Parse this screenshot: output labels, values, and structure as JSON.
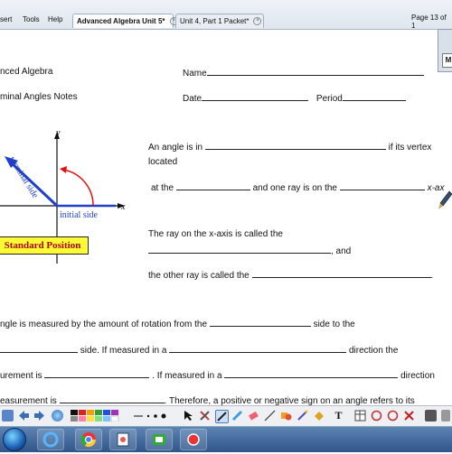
{
  "menu": {
    "insert": "sert",
    "tools": "Tools",
    "help": "Help"
  },
  "tabs": [
    {
      "label": "Advanced Algebra Unit 5*",
      "active": true
    },
    {
      "label": "Unit 4, Part 1 Packet*",
      "active": false
    }
  ],
  "page_indicator": "Page 13 of 1",
  "side_widget": {
    "label": "M"
  },
  "document": {
    "course": "nced Algebra",
    "name_label": "Name",
    "title": "minal  Angles Notes",
    "date_label": "Date",
    "period_label": "Period",
    "standard_position_label": "Standard Position",
    "diagram": {
      "y_label": "y",
      "x_label": "x",
      "terminal_side": "terminal side",
      "initial_side": "initial side"
    },
    "p1_line1": "An angle is in",
    "p1_if": "if its vertex",
    "p1_line2": "located",
    "p1_line3_a": "at the",
    "p1_line3_b": "and one ray is on the",
    "p1_line3_c": "x-ax",
    "p2_line1": "The ray on the x-axis is called the",
    "p2_and": ", and",
    "p2_line3": "the other ray is called the",
    "p2_end": ".",
    "p3_line1_a": "ngle is measured by the amount of rotation from the",
    "p3_line1_b": "side to the",
    "p3_line2_a": "side.  If measured in a",
    "p3_line2_b": "direction the",
    "p3_line3_a": "urement is",
    "p3_line3_b": ".  If measured in a",
    "p3_line3_c": "direction",
    "p3_line4_a": "easurement is",
    "p3_line4_b": ".  Therefore, a positive or negative sign on an angle refers to its"
  },
  "toolbar_icons": [
    "pen-icon",
    "arrow-left-icon",
    "arrow-right-icon",
    "page-icon",
    "globe-icon",
    "color-palette-icon",
    "pen-width-icon",
    "dots-icon",
    "select-arrow-icon",
    "tools-icon",
    "pen-tool-icon",
    "highlighter-icon",
    "eraser-icon",
    "line-icon",
    "shapes-icon",
    "fill-icon",
    "text-tool-icon",
    "undo-icon",
    "redo-icon",
    "delete-icon",
    "screen-shade-icon",
    "toolbar-menu-icon"
  ],
  "taskbar_icons": [
    "start-button",
    "internet-explorer-icon",
    "file-explorer-icon",
    "chrome-icon",
    "smart-notebook-icon",
    "camtasia-icon",
    "record-icon"
  ],
  "colors": {
    "standard_position_fill": "#ffff33",
    "standard_position_text": "#b00000",
    "terminal_arrow": "#1f3fcc",
    "arc": "#dd1111",
    "initial_side_text": "#1f3fcc"
  }
}
